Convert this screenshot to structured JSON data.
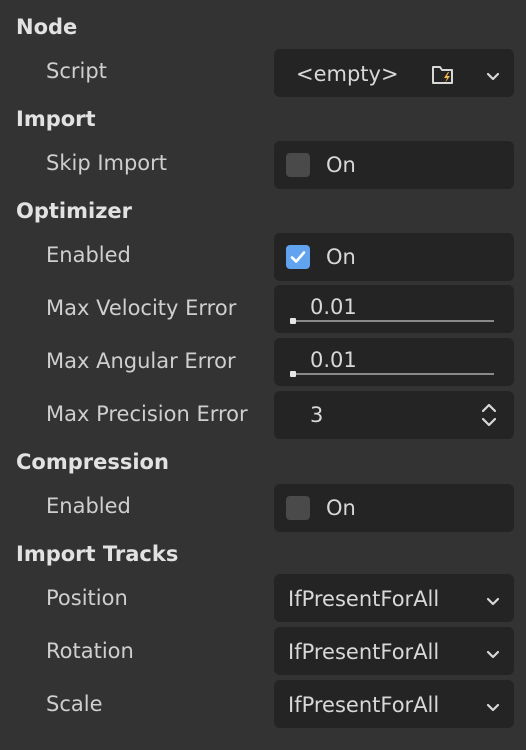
{
  "colors": {
    "background": "#333333",
    "field_background": "#242424",
    "checkbox_checked": "#62a3ef",
    "checkbox_unchecked": "#4a4a4a"
  },
  "node": {
    "header": "Node",
    "script_label": "Script",
    "script_value": "<empty>",
    "script_icons": [
      "load-folder-icon",
      "chevron-down-icon"
    ]
  },
  "import": {
    "header": "Import",
    "skip_import_label": "Skip Import",
    "skip_import_checked": false,
    "skip_import_text": "On"
  },
  "optimizer": {
    "header": "Optimizer",
    "enabled_label": "Enabled",
    "enabled_checked": true,
    "enabled_text": "On",
    "max_velocity_error_label": "Max Velocity Error",
    "max_velocity_error_value": "0.01",
    "max_angular_error_label": "Max Angular Error",
    "max_angular_error_value": "0.01",
    "max_precision_error_label": "Max Precision Error",
    "max_precision_error_value": "3"
  },
  "compression": {
    "header": "Compression",
    "enabled_label": "Enabled",
    "enabled_checked": false,
    "enabled_text": "On"
  },
  "import_tracks": {
    "header": "Import Tracks",
    "position_label": "Position",
    "position_value": "IfPresentForAll",
    "rotation_label": "Rotation",
    "rotation_value": "IfPresentForAll",
    "scale_label": "Scale",
    "scale_value": "IfPresentForAll"
  }
}
